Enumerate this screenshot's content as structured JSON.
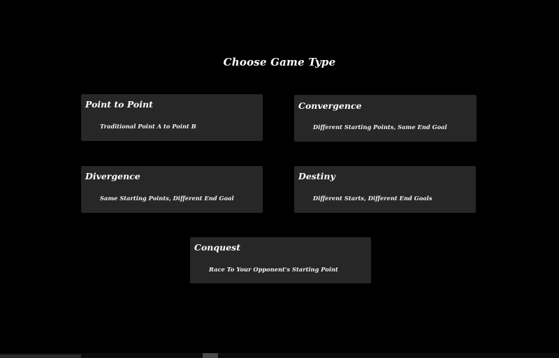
{
  "screen": {
    "title": "Choose Game Type"
  },
  "game_types": [
    {
      "name": "Point to Point",
      "description": "Traditional Point A to Point B"
    },
    {
      "name": "Convergence",
      "description": "Different Starting Points, Same End Goal"
    },
    {
      "name": "Divergence",
      "description": "Same Starting Points, Different End Goal"
    },
    {
      "name": "Destiny",
      "description": "Different Starts, Different End Goals"
    },
    {
      "name": "Conquest",
      "description": "Race To Your Opponent's Starting Point"
    }
  ],
  "colors": {
    "background": "#000000",
    "card": "#272727",
    "text": "#ffffff"
  },
  "taskbar": {
    "icons": [
      "browser-icon",
      "folder-icon",
      "file-icon",
      "store-icon",
      "app-icon",
      "active-app-icon"
    ]
  }
}
